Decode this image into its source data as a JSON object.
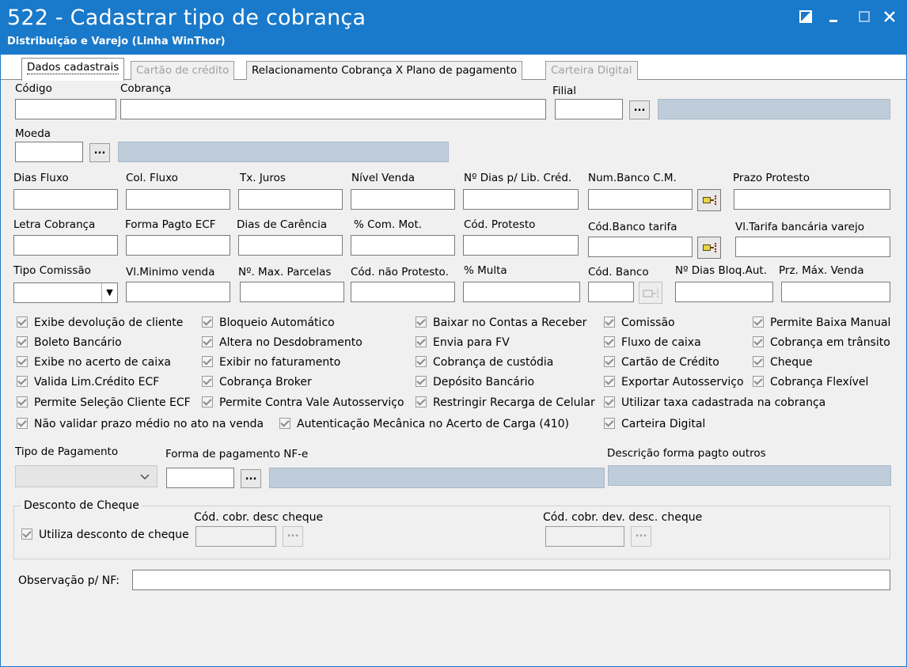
{
  "window": {
    "title": "522 - Cadastrar tipo de cobrança",
    "subtitle": "Distribuição e Varejo (Linha WinThor)"
  },
  "tabs": [
    {
      "label": "Dados cadastrais",
      "state": "active"
    },
    {
      "label": "Cartão de crédito",
      "state": "disabled"
    },
    {
      "label": "Relacionamento Cobrança X Plano de pagamento",
      "state": "enabled"
    },
    {
      "label": "Carteira Digital",
      "state": "disabled"
    }
  ],
  "fields": {
    "codigo": "Código",
    "cobranca": "Cobrança",
    "filial": "Filial",
    "moeda": "Moeda",
    "dias_fluxo": "Dias Fluxo",
    "col_fluxo": "Col. Fluxo",
    "tx_juros": "Tx. Juros",
    "nivel_venda": "Nível Venda",
    "dias_lib_cred": "Nº Dias p/ Lib. Créd.",
    "num_banco_cm": "Num.Banco C.M.",
    "prazo_protesto": "Prazo Protesto",
    "letra_cobranca": "Letra Cobrança",
    "forma_pagto_ecf": "Forma Pagto ECF",
    "dias_carencia": "Dias de Carência",
    "com_mot": "% Com. Mot.",
    "cod_protesto": "Cód. Protesto",
    "cod_banco_tarifa": "Cód.Banco tarifa",
    "vl_tarifa": "Vl.Tarifa bancária varejo",
    "tipo_comissao": "Tipo Comissão",
    "vl_minimo_venda": "Vl.Minimo venda",
    "max_parcelas": "Nº. Max. Parcelas",
    "cod_nao_protesto": "Cód. não Protesto.",
    "multa": "% Multa",
    "cod_banco": "Cód. Banco",
    "dias_bloq_aut": "Nº Dias Bloq.Aut.",
    "prz_max_venda": "Prz. Máx. Venda",
    "tipo_pagamento": "Tipo de Pagamento",
    "forma_pagamento_nfe": "Forma de pagamento NF-e",
    "descricao_forma_pagto": "Descrição forma pagto outros",
    "observacao_nf": "Observação p/ NF:"
  },
  "button_ellipsis": "...",
  "checkboxes": [
    "Exibe devolução de cliente",
    "Boleto Bancário",
    "Exibe no acerto de caixa",
    "Valida Lim.Crédito ECF",
    "Permite Seleção Cliente ECF",
    "Não validar prazo médio no ato na venda",
    "Bloqueio Automático",
    "Altera no Desdobramento",
    "Exibir no faturamento",
    "Cobrança Broker",
    "Permite Contra Vale Autosserviço",
    "Autenticação Mecânica no Acerto de Carga (410)",
    "Baixar no Contas a Receber",
    "Envia para FV",
    "Cobrança de custódia",
    "Depósito Bancário",
    "Restringir Recarga de Celular",
    "Comissão",
    "Fluxo de caixa",
    "Cartão de Crédito",
    "Exportar Autosserviço",
    "Utilizar taxa cadastrada na cobrança",
    "Carteira Digital",
    "Permite Baixa Manual",
    "Cobrança em trânsito",
    "Cheque",
    "Cobrança Flexível"
  ],
  "desconto_cheque": {
    "group_title": "Desconto de Cheque",
    "utiliza": "Utiliza desconto de cheque",
    "cod_cobr_desc": "Cód. cobr. desc cheque",
    "cod_cobr_dev_desc": "Cód. cobr. dev. desc. cheque"
  }
}
